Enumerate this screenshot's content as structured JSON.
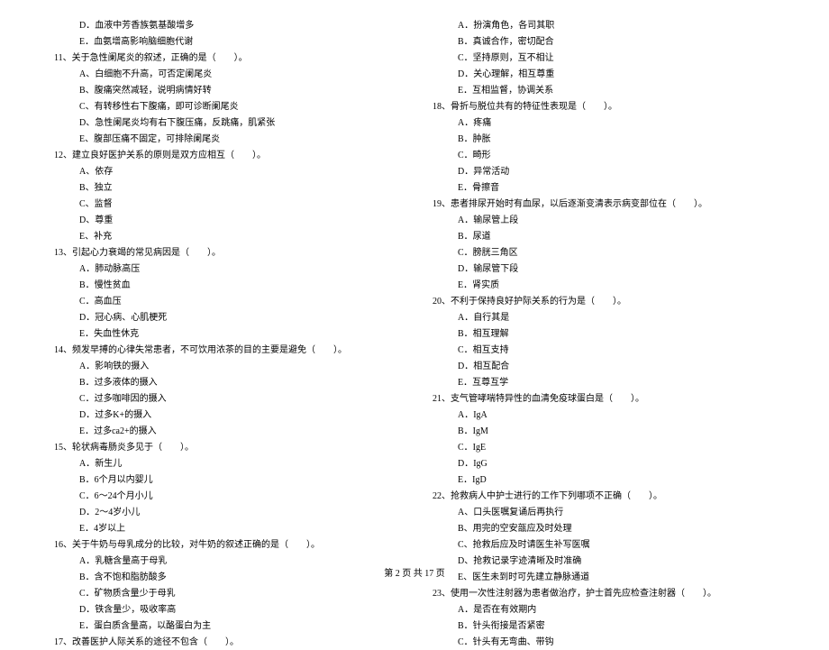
{
  "leftColumn": {
    "preOptions": [
      "D．血液中芳香族氨基酸增多",
      "E．血氨增高影响脑细胞代谢"
    ],
    "items": [
      {
        "num": "11",
        "stem": "、关于急性阑尾炎的叙述，正确的是（　　）。",
        "opts": [
          "A、白细胞不升高，可否定阑尾炎",
          "B、腹痛突然减轻，说明病情好转",
          "C、有转移性右下腹痛，即可诊断阑尾炎",
          "D、急性阑尾炎均有右下腹压痛，反跳痛，肌紧张",
          "E、腹部压痛不固定，可排除阑尾炎"
        ]
      },
      {
        "num": "12",
        "stem": "、建立良好医护关系的原则是双方应相互（　　）。",
        "opts": [
          "A、依存",
          "B、独立",
          "C、监督",
          "D、尊重",
          "E、补充"
        ]
      },
      {
        "num": "13",
        "stem": "、引起心力衰竭的常见病因是（　　）。",
        "opts": [
          "A．肺动脉高压",
          "B．慢性贫血",
          "C．高血压",
          "D．冠心病、心肌梗死",
          "E．失血性休克"
        ]
      },
      {
        "num": "14",
        "stem": "、频发早搏的心律失常患者，不可饮用浓茶的目的主要是避免（　　）。",
        "opts": [
          "A．影响铁的摄入",
          "B．过多液体的摄入",
          "C．过多咖啡因的摄入",
          "D．过多K+的摄入",
          "E．过多ca2+的摄入"
        ]
      },
      {
        "num": "15",
        "stem": "、轮状病毒肠炎多见于（　　）。",
        "opts": [
          "A．新生儿",
          "B．6个月以内婴儿",
          "C．6～24个月小儿",
          "D．2～4岁小儿",
          "E．4岁以上"
        ]
      },
      {
        "num": "16",
        "stem": "、关于牛奶与母乳成分的比较，对牛奶的叙述正确的是（　　）。",
        "opts": [
          "A．乳糖含量高于母乳",
          "B．含不饱和脂肪酸多",
          "C．矿物质含量少于母乳",
          "D．铁含量少，吸收率高",
          "E．蛋白质含量高，以酪蛋白为主"
        ]
      },
      {
        "num": "17",
        "stem": "、改善医护人际关系的途径不包含（　　）。",
        "opts": []
      }
    ]
  },
  "rightColumn": {
    "preOptions": [
      "A．扮演角色，各司其职",
      "B．真诚合作，密切配合",
      "C．坚持原则，互不相让",
      "D．关心理解，相互尊重",
      "E．互相监督，协调关系"
    ],
    "items": [
      {
        "num": "18",
        "stem": "、骨折与脱位共有的特征性表现是（　　）。",
        "opts": [
          "A．疼痛",
          "B．肿胀",
          "C．畸形",
          "D．异常活动",
          "E．骨擦音"
        ]
      },
      {
        "num": "19",
        "stem": "、患者排尿开始时有血尿，以后逐渐变清表示病变部位在（　　）。",
        "opts": [
          "A．输尿管上段",
          "B．尿道",
          "C．膀胱三角区",
          "D．输尿管下段",
          "E．肾实质"
        ]
      },
      {
        "num": "20",
        "stem": "、不利于保持良好护际关系的行为是（　　）。",
        "opts": [
          "A．自行其是",
          "B．相互理解",
          "C．相互支持",
          "D．相互配合",
          "E．互尊互学"
        ]
      },
      {
        "num": "21",
        "stem": "、支气管哮喘特异性的血清免疫球蛋白是（　　）。",
        "opts": [
          "A．IgA",
          "B．IgM",
          "C．IgE",
          "D．IgG",
          "E．IgD"
        ]
      },
      {
        "num": "22",
        "stem": "、抢救病人中护士进行的工作下列哪项不正确（　　）。",
        "opts": [
          "A、口头医嘱复诵后再执行",
          "B、用完的空安瓿应及时处理",
          "C、抢救后应及时请医生补写医嘱",
          "D、抢救记录字迹清晰及时准确",
          "E、医生未到时可先建立静脉通道"
        ]
      },
      {
        "num": "23",
        "stem": "、使用一次性注射器为患者做治疗，护士首先应检查注射器（　　）。",
        "opts": [
          "A．是否在有效期内",
          "B．针头衔接是否紧密",
          "C．针头有无弯曲、带钩"
        ]
      }
    ]
  },
  "footer": "第 2 页 共 17 页"
}
